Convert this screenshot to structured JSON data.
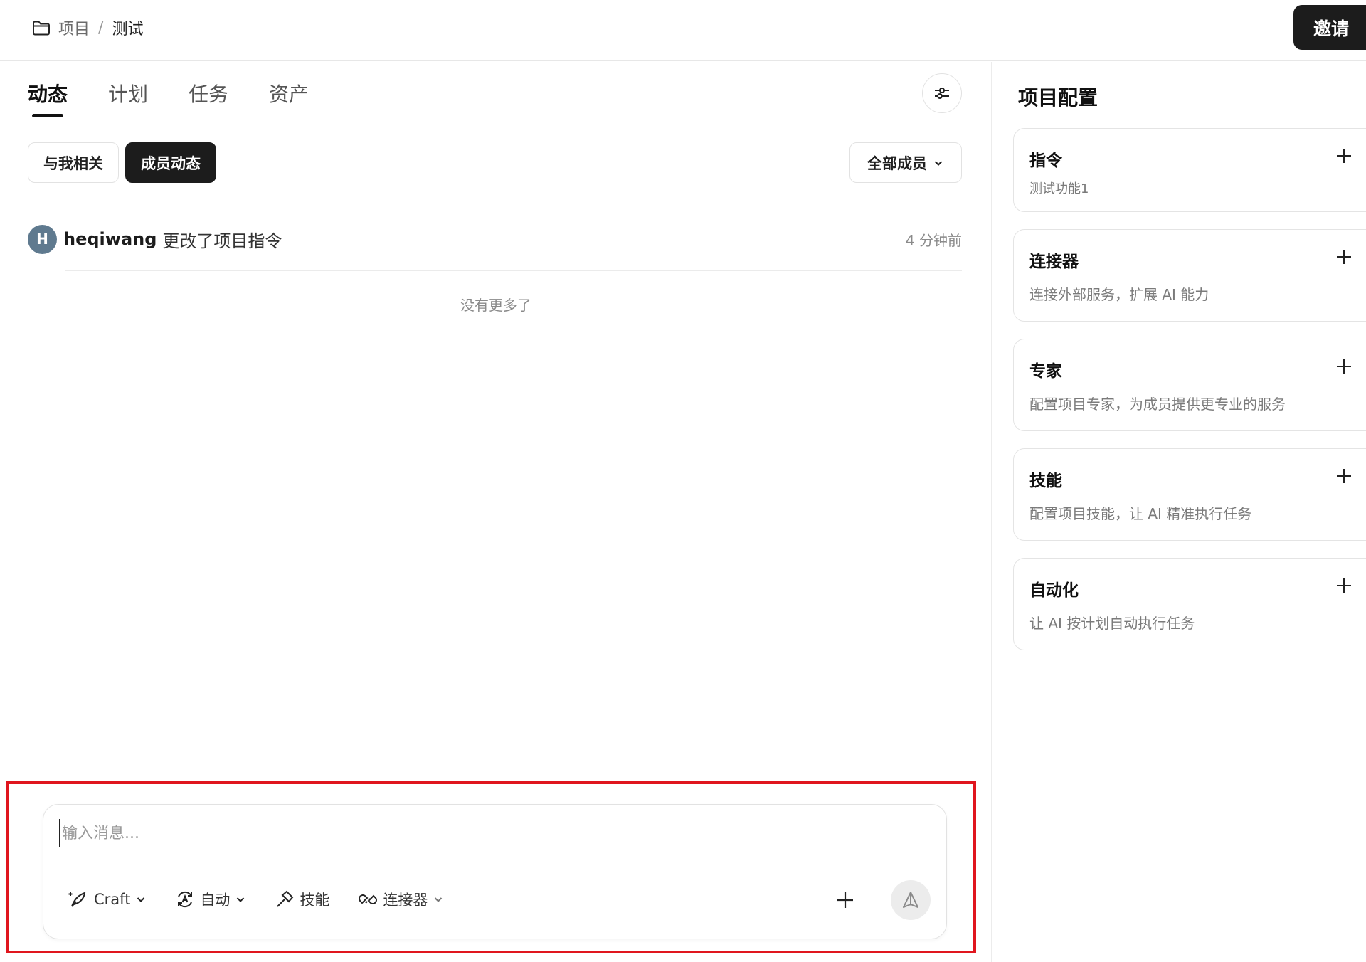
{
  "breadcrumb": {
    "root": "项目",
    "separator": "/",
    "current": "测试",
    "icon": "folder-icon"
  },
  "header": {
    "invite_label": "邀请"
  },
  "tabs": [
    {
      "label": "动态",
      "active": true
    },
    {
      "label": "计划",
      "active": false
    },
    {
      "label": "任务",
      "active": false
    },
    {
      "label": "资产",
      "active": false
    }
  ],
  "filters": {
    "chips": [
      {
        "label": "与我相关",
        "active": false
      },
      {
        "label": "成员动态",
        "active": true
      }
    ],
    "member_select": "全部成员"
  },
  "feed": {
    "items": [
      {
        "avatar_initial": "H",
        "user": "heqiwang",
        "action": "更改了项目指令",
        "time": "4 分钟前"
      }
    ],
    "end_text": "没有更多了"
  },
  "composer": {
    "placeholder": "输入消息...",
    "tools": {
      "mode": "Craft",
      "auto": "自动",
      "skills": "技能",
      "connectors": "连接器"
    }
  },
  "config": {
    "title": "项目配置",
    "cards": [
      {
        "title": "指令",
        "desc": "测试功能1"
      },
      {
        "title": "连接器",
        "desc": "连接外部服务，扩展 AI 能力"
      },
      {
        "title": "专家",
        "desc": "配置项目专家，为成员提供更专业的服务"
      },
      {
        "title": "技能",
        "desc": "配置项目技能，让 AI 精准执行任务"
      },
      {
        "title": "自动化",
        "desc": "让 AI 按计划自动执行任务"
      }
    ]
  },
  "colors": {
    "accent_dark": "#1c1c1c",
    "avatar": "#5f7a8f",
    "highlight": "#e0161e"
  }
}
